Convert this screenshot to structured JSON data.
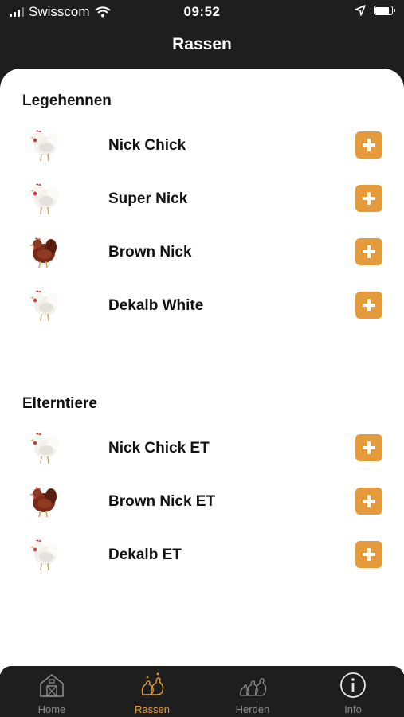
{
  "status_bar": {
    "carrier": "Swisscom",
    "time": "09:52"
  },
  "header": {
    "title": "Rassen"
  },
  "sections": [
    {
      "title": "Legehennen",
      "items": [
        {
          "name": "Nick Chick",
          "bird": "white-hen"
        },
        {
          "name": "Super Nick",
          "bird": "white-hen"
        },
        {
          "name": "Brown Nick",
          "bird": "brown-hen"
        },
        {
          "name": "Dekalb White",
          "bird": "white-hen"
        }
      ]
    },
    {
      "title": "Elterntiere",
      "items": [
        {
          "name": "Nick Chick ET",
          "bird": "white-hen"
        },
        {
          "name": "Brown Nick ET",
          "bird": "brown-hen"
        },
        {
          "name": "Dekalb ET",
          "bird": "white-hen"
        }
      ]
    }
  ],
  "tab_bar": {
    "tabs": [
      {
        "label": "Home",
        "icon": "barn-icon",
        "active": false
      },
      {
        "label": "Rassen",
        "icon": "chickens-icon",
        "active": true
      },
      {
        "label": "Herden",
        "icon": "flock-icon",
        "active": false
      },
      {
        "label": "Info",
        "icon": "info-icon",
        "active": false
      }
    ]
  },
  "colors": {
    "accent": "#e59a3c",
    "background": "#1e1e1e",
    "content": "#ffffff",
    "inactive": "#8d8d8d"
  }
}
